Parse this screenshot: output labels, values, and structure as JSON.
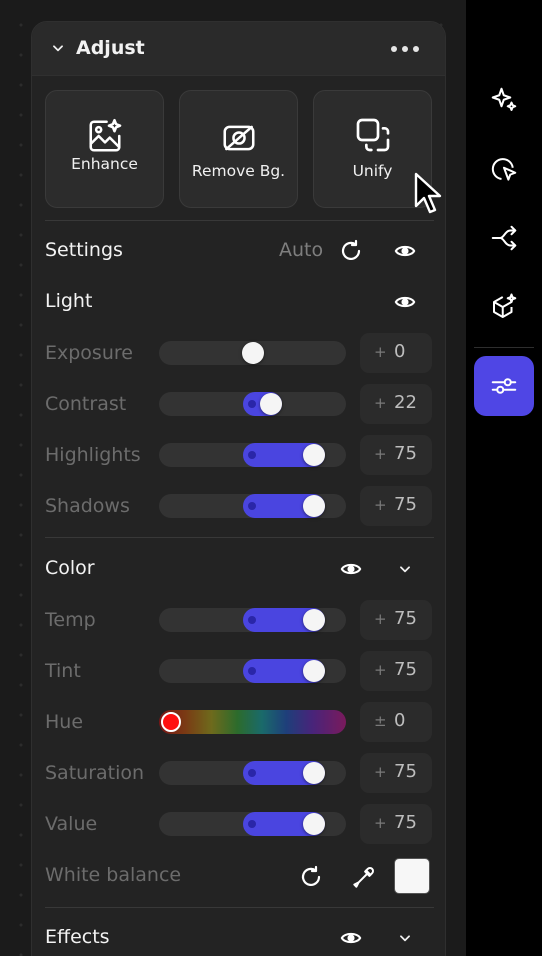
{
  "panel": {
    "title": "Adjust",
    "icons": {
      "collapse": "chevron-down-icon",
      "menu": "more-dots-icon"
    }
  },
  "tools": [
    {
      "label": "Enhance",
      "icon": "image-sparkle-icon"
    },
    {
      "label": "Remove Bg.",
      "icon": "remove-background-icon"
    },
    {
      "label": "Unify",
      "icon": "unify-icon"
    }
  ],
  "settings": {
    "title": "Settings",
    "auto_label": "Auto"
  },
  "light": {
    "title": "Light",
    "rows": [
      {
        "label": "Exposure",
        "sign": "+",
        "value": "0",
        "level": 0.5
      },
      {
        "label": "Contrast",
        "sign": "+",
        "value": "22",
        "level": 0.61
      },
      {
        "label": "Highlights",
        "sign": "+",
        "value": "75",
        "level": 0.875
      },
      {
        "label": "Shadows",
        "sign": "+",
        "value": "75",
        "level": 0.875
      }
    ]
  },
  "color": {
    "title": "Color",
    "rows": [
      {
        "label": "Temp",
        "sign": "+",
        "value": "75",
        "level": 0.875
      },
      {
        "label": "Tint",
        "sign": "+",
        "value": "75",
        "level": 0.875
      },
      {
        "label": "Hue",
        "sign": "±",
        "value": "0",
        "level": 0.0
      },
      {
        "label": "Saturation",
        "sign": "+",
        "value": "75",
        "level": 0.875
      },
      {
        "label": "Value",
        "sign": "+",
        "value": "75",
        "level": 0.875
      }
    ],
    "white_balance": {
      "label": "White balance",
      "swatch_color": "#f7f7f7"
    }
  },
  "effects": {
    "title": "Effects"
  },
  "rail": {
    "items": [
      {
        "icon": "sparkles-icon",
        "active": false
      },
      {
        "icon": "magic-select-icon",
        "active": false
      },
      {
        "icon": "branch-arrows-icon",
        "active": false
      },
      {
        "icon": "cube-sparkle-icon",
        "active": false
      },
      {
        "icon": "sliders-icon",
        "active": true
      }
    ]
  },
  "colors": {
    "accent": "#4f46e5",
    "panel": "#232323",
    "rail": "#000000"
  }
}
